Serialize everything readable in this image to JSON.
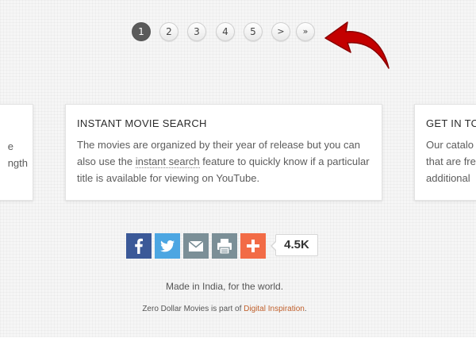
{
  "pagination": {
    "pages": [
      "1",
      "2",
      "3",
      "4",
      "5"
    ],
    "active_page": "1",
    "next_label": ">",
    "last_label": "»",
    "arrow_color": "#c30000"
  },
  "cards": {
    "left": {
      "lines": [
        "e",
        "ngth"
      ]
    },
    "center": {
      "title": "INSTANT MOVIE SEARCH",
      "body_before": "The movies are organized by their year of release but you can also use the ",
      "body_link": "instant search",
      "body_after": " feature to quickly know if a particular title is available for viewing on YouTube."
    },
    "right": {
      "title": "GET IN TO",
      "lines": [
        "Our catalo",
        "that are fre",
        "additional"
      ]
    }
  },
  "share": {
    "buttons": [
      "facebook-icon",
      "twitter-icon",
      "mail-icon",
      "print-icon",
      "plus-icon"
    ],
    "colors": {
      "facebook": "#3b5998",
      "twitter": "#4ca6e2",
      "mail": "#7b8f97",
      "print": "#7b8f97",
      "plus": "#f26b46"
    },
    "count": "4.5K"
  },
  "footer": {
    "tagline": "Made in India, for the world.",
    "credit_prefix": "Zero Dollar Movies is part of ",
    "credit_link": "Digital Inspiration",
    "credit_suffix": "."
  }
}
